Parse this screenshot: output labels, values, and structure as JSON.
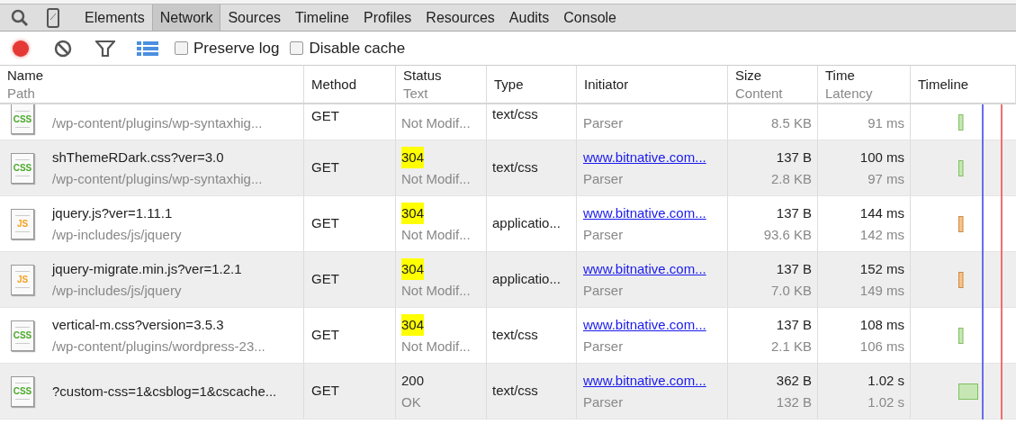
{
  "tabs": [
    {
      "label": "Elements",
      "selected": false
    },
    {
      "label": "Network",
      "selected": true
    },
    {
      "label": "Sources",
      "selected": false
    },
    {
      "label": "Timeline",
      "selected": false
    },
    {
      "label": "Profiles",
      "selected": false
    },
    {
      "label": "Resources",
      "selected": false
    },
    {
      "label": "Audits",
      "selected": false
    },
    {
      "label": "Console",
      "selected": false
    }
  ],
  "toolbar": {
    "recording": true,
    "large_rows": true,
    "options": [
      {
        "label": "Preserve log",
        "checked": false
      },
      {
        "label": "Disable cache",
        "checked": false
      }
    ]
  },
  "columns": [
    {
      "title": "Name",
      "subtitle": "Path"
    },
    {
      "title": "Method"
    },
    {
      "title": "Status",
      "subtitle": "Text"
    },
    {
      "title": "Type"
    },
    {
      "title": "Initiator"
    },
    {
      "title": "Size",
      "subtitle": "Content"
    },
    {
      "title": "Time",
      "subtitle": "Latency"
    },
    {
      "title": "Timeline"
    }
  ],
  "rows": [
    {
      "kind": "css",
      "icon_label": "CSS",
      "path": "/wp-content/plugins/wp-syntaxhig...",
      "method": "GET",
      "status_text": "Not Modif...",
      "type": "text/css",
      "initiator_type": "Parser",
      "content": "8.5 KB",
      "latency": "91 ms",
      "level": 0.05
    },
    {
      "kind": "css",
      "icon_label": "CSS",
      "name": "shThemeRDark.css?ver=3.0",
      "path": "/wp-content/plugins/wp-syntaxhig...",
      "method": "GET",
      "status": "304",
      "status_highlighted": true,
      "status_text": "Not Modif...",
      "type": "text/css",
      "initiator": "www.bitnative.com...",
      "initiator_type": "Parser",
      "size": "137 B",
      "content": "2.8 KB",
      "time": "100 ms",
      "latency": "97 ms",
      "level": 0.05
    },
    {
      "kind": "js",
      "icon_label": "JS",
      "name": "jquery.js?ver=1.11.1",
      "path": "/wp-includes/js/jquery",
      "method": "GET",
      "status": "304",
      "status_highlighted": true,
      "status_text": "Not Modif...",
      "type": "applicatio...",
      "initiator": "www.bitnative.com...",
      "initiator_type": "Parser",
      "size": "137 B",
      "content": "93.6 KB",
      "time": "144 ms",
      "latency": "142 ms",
      "level": 0.05
    },
    {
      "kind": "js",
      "icon_label": "JS",
      "name": "jquery-migrate.min.js?ver=1.2.1",
      "path": "/wp-includes/js/jquery",
      "method": "GET",
      "status": "304",
      "status_highlighted": true,
      "status_text": "Not Modif...",
      "type": "applicatio...",
      "initiator": "www.bitnative.com...",
      "initiator_type": "Parser",
      "size": "137 B",
      "content": "7.0 KB",
      "time": "152 ms",
      "latency": "149 ms",
      "level": 0.05
    },
    {
      "kind": "css",
      "icon_label": "CSS",
      "name": "vertical-m.css?version=3.5.3",
      "path": "/wp-content/plugins/wordpress-23...",
      "method": "GET",
      "status": "304",
      "status_highlighted": true,
      "status_text": "Not Modif...",
      "type": "text/css",
      "initiator": "www.bitnative.com...",
      "initiator_type": "Parser",
      "size": "137 B",
      "content": "2.1 KB",
      "time": "108 ms",
      "latency": "106 ms",
      "level": 0.05
    },
    {
      "kind": "css",
      "icon_label": "CSS",
      "name": "?custom-css=1&csblog=1&cscache...",
      "method": "GET",
      "status": "200",
      "status_highlighted": false,
      "status_text": "OK",
      "type": "text/css",
      "initiator": "www.bitnative.com...",
      "initiator_type": "Parser",
      "size": "362 B",
      "content": "132 B",
      "time": "1.02 s",
      "latency": "1.02 s",
      "level": 0.2
    }
  ]
}
